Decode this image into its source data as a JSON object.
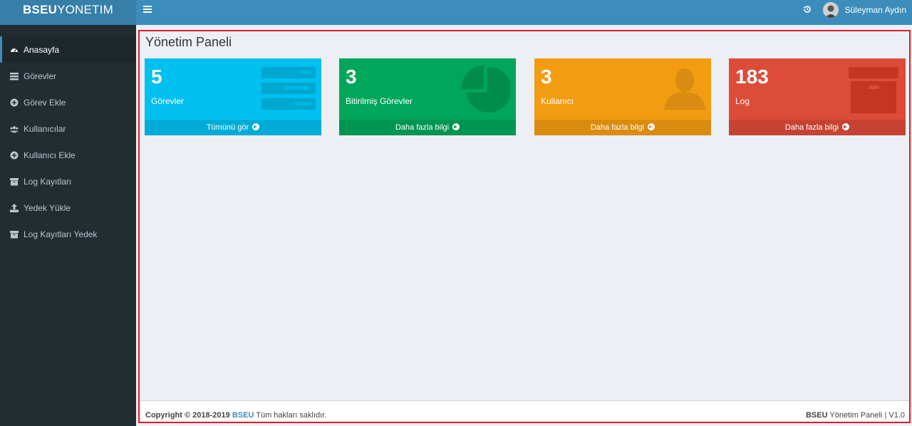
{
  "header": {
    "logo_bold": "BSEU",
    "logo_rest": "YONETIM",
    "user_name": "Süleyman Aydın"
  },
  "sidebar": {
    "items": [
      {
        "label": "Anasayfa",
        "icon": "dashboard-icon",
        "active": true
      },
      {
        "label": "Görevler",
        "icon": "tasks-icon"
      },
      {
        "label": "Görev Ekle",
        "icon": "plus-circle-icon"
      },
      {
        "label": "Kullanıcılar",
        "icon": "users-icon"
      },
      {
        "label": "Kullanıcı Ekle",
        "icon": "plus-circle-icon"
      },
      {
        "label": "Log Kayıtları",
        "icon": "archive-icon"
      },
      {
        "label": "Yedek Yükle",
        "icon": "upload-icon"
      },
      {
        "label": "Log Kayıtları Yedek",
        "icon": "archive-icon"
      }
    ]
  },
  "main": {
    "title": "Yönetim Paneli",
    "boxes": [
      {
        "value": "5",
        "label": "Görevler",
        "link": "Tümünü gör",
        "color": "#00c0ef",
        "icon": "tasks-icon"
      },
      {
        "value": "3",
        "label": "Bitirilmiş Görevler",
        "link": "Daha fazla bilgi",
        "color": "#00a65a",
        "icon": "pie-chart-icon"
      },
      {
        "value": "3",
        "label": "Kullanıcı",
        "link": "Daha fazla bilgi",
        "color": "#f39c12",
        "icon": "user-icon"
      },
      {
        "value": "183",
        "label": "Log",
        "link": "Daha fazla bilgi",
        "color": "#dd4b39",
        "icon": "archive-icon"
      }
    ]
  },
  "footer": {
    "copyright": "Copyright © 2018-2019",
    "brand": "BSEU",
    "rights": "Tüm hakları saklıdır.",
    "app_brand": "BSEU",
    "app_name": "Yönetim Paneli",
    "version": "| V1.0"
  }
}
